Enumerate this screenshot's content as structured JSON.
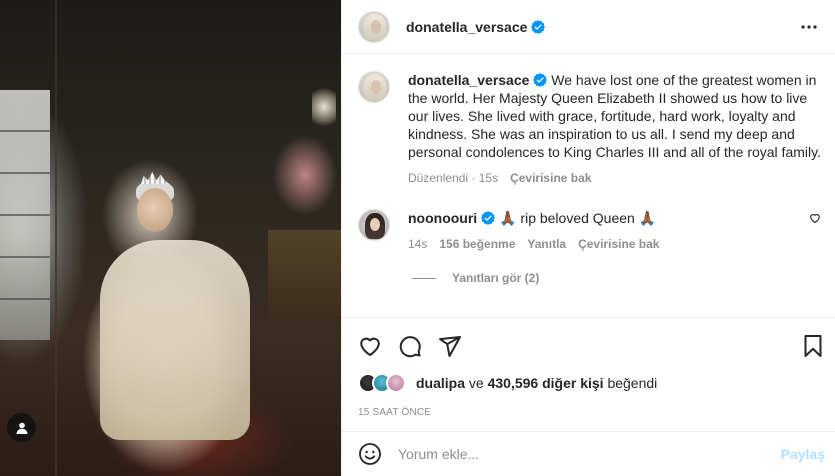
{
  "post": {
    "author": "donatella_versace",
    "more_icon": "more-horizontal-icon"
  },
  "caption": {
    "username": "donatella_versace",
    "text": "We have lost one of the greatest women in the world. Her Majesty Queen Elizabeth II showed us how to live our lives. She lived with grace, fortitude, hard work, loyalty and kindness. She was an inspiration to us all. I send my deep and personal condolences to King Charles III and all of the royal family.",
    "edited": "Düzenlendi",
    "age": "15s",
    "translate": "Çevirisine bak"
  },
  "comment": {
    "username": "noonoouri",
    "text": "🙏🏾 rip beloved Queen 🙏🏾",
    "age": "14s",
    "likes": "156 beğenme",
    "reply": "Yanıtla",
    "translate": "Çevirisine bak",
    "view_replies": "Yanıtları gör (2)"
  },
  "liked_by": {
    "first": "dualipa",
    "connector": "ve",
    "others": "430,596 diğer kişi",
    "suffix": "beğendi"
  },
  "timestamp": "15 SAAT ÖNCE",
  "add_comment": {
    "placeholder": "Yorum ekle...",
    "post_label": "Paylaş"
  },
  "colors": {
    "verified": "#0095f6",
    "muted": "#8e8e8e",
    "post_disabled": "#b2dffc"
  }
}
